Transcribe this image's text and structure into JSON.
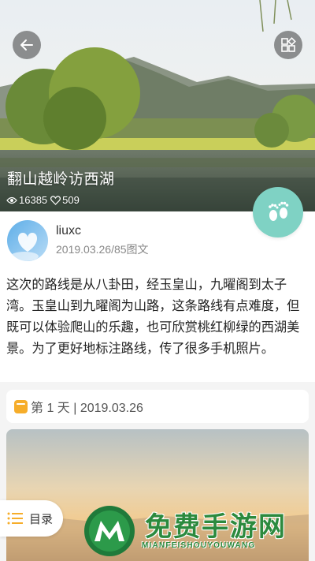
{
  "hero": {
    "title": "翻山越岭访西湖",
    "views": "16385",
    "likes": "509",
    "back_icon": "arrow-left-icon",
    "grid_icon": "grid-apps-icon"
  },
  "author": {
    "name": "liuxc",
    "meta": "2019.03.26/85图文"
  },
  "intro": "这次的路线是从八卦田，经玉皇山，九曜阁到太子湾。玉皇山到九曜阁为山路，这条路线有点难度，但既可以体验爬山的乐趣，也可欣赏桃红柳绿的西湖美景。为了更好地标注路线，传了很多手机照片。",
  "day": {
    "label": "第 1 天 | 2019.03.26"
  },
  "toc": {
    "label": "目录"
  },
  "watermark": {
    "title": "免费手游网",
    "subtitle": "MIANFEISHOUYOUWANG"
  },
  "colors": {
    "accent_teal": "#7fd2c4",
    "day_icon": "#f6ad2a",
    "watermark_green": "#2c8a3e"
  }
}
